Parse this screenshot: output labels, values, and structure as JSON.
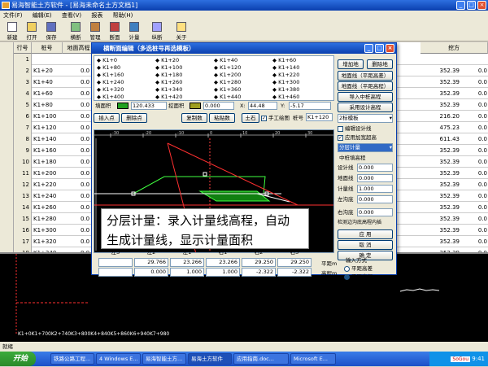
{
  "app": {
    "title": "易海智能土方软件 - [易海未命名土方文档1]",
    "win_btns": [
      "_",
      "□",
      "×"
    ]
  },
  "menubar": [
    "文件(F)",
    "编辑(E)",
    "查看(V)",
    "报表",
    "帮助(H)"
  ],
  "toolbar": [
    "新建",
    "打开",
    "保存",
    "横断",
    "管理",
    "断面",
    "计量",
    "纵断",
    "关于"
  ],
  "grid": {
    "headers": {
      "rowno": "行号",
      "station": "桩号",
      "ground": "地面高程",
      "fill_area": "挖方",
      "col_a": "普通土",
      "col_b": "硬土",
      "col_c": "次坚"
    },
    "rows": [
      {
        "n": "1",
        "station": "",
        "z": "",
        "r1": "",
        "r2": ""
      },
      {
        "n": "2",
        "station": "K1+20",
        "z": "0.0",
        "r1": "352.39",
        "r2": "0.0"
      },
      {
        "n": "3",
        "station": "K1+40",
        "z": "0.0",
        "r1": "352.39",
        "r2": "0.0"
      },
      {
        "n": "4",
        "station": "K1+60",
        "z": "0.0",
        "r1": "352.39",
        "r2": "0.0"
      },
      {
        "n": "5",
        "station": "K1+80",
        "z": "0.0",
        "r1": "352.39",
        "r2": "0.0"
      },
      {
        "n": "6",
        "station": "K1+100",
        "z": "0.0",
        "r1": "216.20",
        "r2": "0.0"
      },
      {
        "n": "7",
        "station": "K1+120",
        "z": "0.0",
        "r1": "475.23",
        "r2": "0.0"
      },
      {
        "n": "8",
        "station": "K1+140",
        "z": "0.0",
        "r1": "611.43",
        "r2": "0.0"
      },
      {
        "n": "9",
        "station": "K1+160",
        "z": "0.0",
        "r1": "352.39",
        "r2": "0.0"
      },
      {
        "n": "10",
        "station": "K1+180",
        "z": "0.0",
        "r1": "352.39",
        "r2": "0.0"
      },
      {
        "n": "11",
        "station": "K1+200",
        "z": "0.0",
        "r1": "352.39",
        "r2": "0.0"
      },
      {
        "n": "12",
        "station": "K1+220",
        "z": "0.0",
        "r1": "352.39",
        "r2": "0.0"
      },
      {
        "n": "13",
        "station": "K1+240",
        "z": "0.0",
        "r1": "352.39",
        "r2": "0.0"
      },
      {
        "n": "14",
        "station": "K1+260",
        "z": "0.0",
        "r1": "352.39",
        "r2": "0.0"
      },
      {
        "n": "15",
        "station": "K1+280",
        "z": "0.0",
        "r1": "352.39",
        "r2": "0.0"
      },
      {
        "n": "16",
        "station": "K1+300",
        "z": "0.0",
        "r1": "352.39",
        "r2": "0.0"
      },
      {
        "n": "17",
        "station": "K1+320",
        "z": "0.0",
        "r1": "352.39",
        "r2": "0.0"
      },
      {
        "n": "18",
        "station": "K1+340",
        "z": "0.0",
        "r1": "352.39",
        "r2": "0.0"
      }
    ]
  },
  "lower_pane": {
    "chainage_text": "K1+0K1+700K2+740K3+800K4+840K5+860K6+940K7+980"
  },
  "statusbar": "就绪",
  "dialog": {
    "title": "横断面编辑（多选桩号再选模板）",
    "stations": [
      [
        "K1+0",
        "K1+20",
        "K1+40",
        "K1+60"
      ],
      [
        "K1+80",
        "K1+100",
        "K1+120",
        "K1+140"
      ],
      [
        "K1+160",
        "K1+180",
        "K1+200",
        "K1+220"
      ],
      [
        "K1+240",
        "K1+260",
        "K1+280",
        "K1+300"
      ],
      [
        "K1+320",
        "K1+340",
        "K1+360",
        "K1+380"
      ],
      [
        "K1+400",
        "K1+420",
        "K1+440",
        "K1+460"
      ]
    ],
    "fill_label": "填面积",
    "fill_value": "120.433",
    "cut_label": "挖面积",
    "cut_value": "0.000",
    "x_label": "X:",
    "x_value": "44.48",
    "y_label": "Y:",
    "y_value": "-5.17",
    "row2": {
      "insert": "插入点",
      "delete": "删除点",
      "copy": "复制数",
      "paste": "粘贴数",
      "soil": "土石",
      "manual": "手工绘图",
      "station_label": "桩号",
      "station_value": "K1+120"
    },
    "right": {
      "add_ground": "增加地",
      "delete_ground": "删除地",
      "draw_line1": "地面线（平距高差）",
      "draw_line2": "地面线（平距高程）",
      "import_center": "导入中桩高程",
      "use_design": "采用设计高程",
      "template_select": "2标模板",
      "chk_edit_design": "编辑设计线",
      "chk_apply_all": "应用加宽超高",
      "layer_select": "分层计量",
      "center_height": "中桩填高程",
      "design_line_label": "设计线",
      "design_line_value": "0.000",
      "ground_line_label": "地面线",
      "ground_line_value": "0.000",
      "measure_line_label": "计量线",
      "measure_line_value": "1.000",
      "left_ditch_label": "左沟底",
      "left_ditch_value": "0.000",
      "right_ditch_label": "右沟底",
      "right_ditch_value": "0.000",
      "detect_ditch": "检测边沟底高程内插",
      "apply": "应  用",
      "cancel": "取  消",
      "ok": "确  定"
    },
    "axis_ticks": [
      "-30",
      "-20",
      "-10",
      "0",
      "10",
      "20",
      "30"
    ],
    "bottom_table": {
      "headers": [
        "左3",
        "左2",
        "左1",
        "右1",
        "右2",
        "右3"
      ],
      "row1": [
        "",
        "29.766",
        "23.266",
        "23.266",
        "29.250",
        "29.250"
      ],
      "row2": [
        "",
        "0.000",
        "1.000",
        "1.000",
        "-2.322",
        "-2.322"
      ],
      "row1_label": "平距m",
      "row2_label": "高程m"
    },
    "input_mode": {
      "label": "输入方式",
      "opt1": "平距高差",
      "opt2": "平距高程"
    }
  },
  "annotation": {
    "line1": "分层计量：录入计量线高程，自动",
    "line2": "生成计量线，显示计量面积"
  },
  "taskbar": {
    "start": "开始",
    "items": [
      "铁路公路工程...",
      "4 Windows E...",
      "易海智能土方...",
      "易海土方软件",
      "应用指南.doc...",
      "Microsoft E..."
    ],
    "tray_time": "9:41",
    "sogou": "SoGou"
  }
}
